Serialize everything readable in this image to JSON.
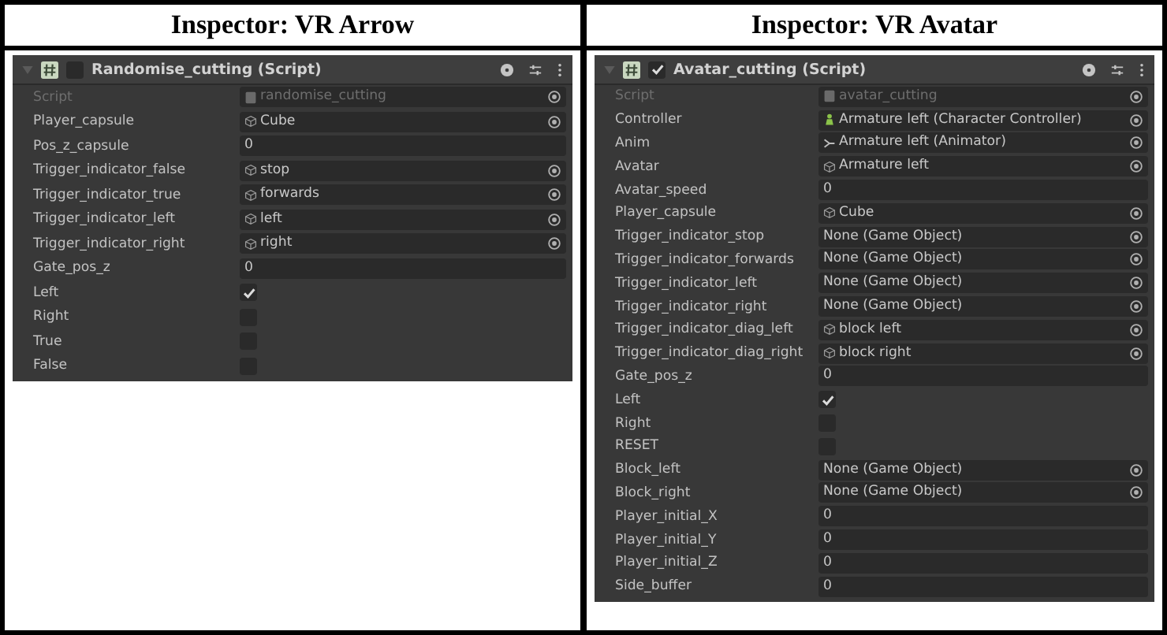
{
  "inspectors": [
    {
      "heading": "Inspector: VR Arrow",
      "component": {
        "title": "Randomise_cutting (Script)",
        "enabled": false
      },
      "rows": [
        {
          "label": "Script",
          "kind": "script",
          "value": "randomise_cutting"
        },
        {
          "label": "Player_capsule",
          "kind": "gameobject",
          "value": "Cube"
        },
        {
          "label": "Pos_z_capsule",
          "kind": "number",
          "value": "0"
        },
        {
          "label": "Trigger_indicator_false",
          "kind": "gameobject",
          "value": "stop"
        },
        {
          "label": "Trigger_indicator_true",
          "kind": "gameobject",
          "value": "forwards"
        },
        {
          "label": "Trigger_indicator_left",
          "kind": "gameobject",
          "value": "left"
        },
        {
          "label": "Trigger_indicator_right",
          "kind": "gameobject",
          "value": "right"
        },
        {
          "label": "Gate_pos_z",
          "kind": "number",
          "value": "0"
        },
        {
          "label": "Left",
          "kind": "toggle",
          "checked": true
        },
        {
          "label": "Right",
          "kind": "toggle",
          "checked": false
        },
        {
          "label": "True",
          "kind": "toggle",
          "checked": false
        },
        {
          "label": "False",
          "kind": "toggle",
          "checked": false
        }
      ]
    },
    {
      "heading": "Inspector: VR Avatar",
      "component": {
        "title": "Avatar_cutting (Script)",
        "enabled": true
      },
      "rows": [
        {
          "label": "Script",
          "kind": "script",
          "value": "avatar_cutting"
        },
        {
          "label": "Controller",
          "kind": "controller",
          "value": "Armature left (Character Controller)"
        },
        {
          "label": "Anim",
          "kind": "animator",
          "value": "Armature left (Animator)"
        },
        {
          "label": "Avatar",
          "kind": "gameobject",
          "value": "Armature left"
        },
        {
          "label": "Avatar_speed",
          "kind": "number",
          "value": "0"
        },
        {
          "label": "Player_capsule",
          "kind": "gameobject",
          "value": "Cube"
        },
        {
          "label": "Trigger_indicator_stop",
          "kind": "reference",
          "value": "None (Game Object)"
        },
        {
          "label": "Trigger_indicator_forwards",
          "kind": "reference",
          "value": "None (Game Object)"
        },
        {
          "label": "Trigger_indicator_left",
          "kind": "reference",
          "value": "None (Game Object)"
        },
        {
          "label": "Trigger_indicator_right",
          "kind": "reference",
          "value": "None (Game Object)"
        },
        {
          "label": "Trigger_indicator_diag_left",
          "kind": "gameobject",
          "value": "block left"
        },
        {
          "label": "Trigger_indicator_diag_right",
          "kind": "gameobject",
          "value": "block right"
        },
        {
          "label": "Gate_pos_z",
          "kind": "number",
          "value": "0"
        },
        {
          "label": "Left",
          "kind": "toggle",
          "checked": true
        },
        {
          "label": "Right",
          "kind": "toggle",
          "checked": false
        },
        {
          "label": "RESET",
          "kind": "toggle",
          "checked": false
        },
        {
          "label": "Block_left",
          "kind": "reference",
          "value": "None (Game Object)"
        },
        {
          "label": "Block_right",
          "kind": "reference",
          "value": "None (Game Object)"
        },
        {
          "label": "Player_initial_X",
          "kind": "number",
          "value": "0"
        },
        {
          "label": "Player_initial_Y",
          "kind": "number",
          "value": "0"
        },
        {
          "label": "Player_initial_Z",
          "kind": "number",
          "value": "0"
        },
        {
          "label": "Side_buffer",
          "kind": "number",
          "value": "0"
        }
      ]
    }
  ]
}
